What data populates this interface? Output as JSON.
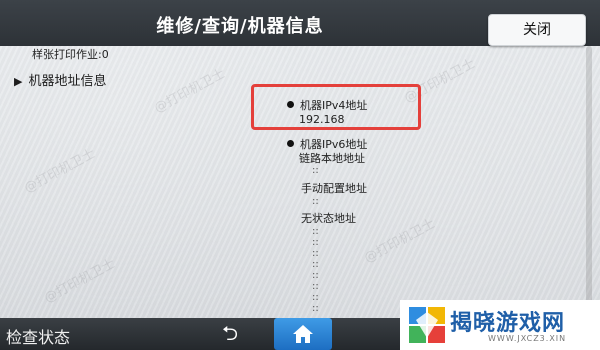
{
  "header": {
    "title": "维修/查询/机器信息",
    "close_label": "关闭"
  },
  "content": {
    "partial_line": "样张打印作业:0",
    "section_label": "机器地址信息",
    "ipv4": {
      "label": "机器IPv4地址",
      "value": "192.168"
    },
    "ipv6": {
      "label": "机器IPv6地址",
      "link_local_label": "链路本地地址",
      "link_local_value": "::",
      "manual_label": "手动配置地址",
      "manual_value": "::",
      "stateless_label": "无状态地址",
      "stateless_values": [
        "::",
        "::",
        "::",
        "::",
        "::",
        "::",
        "::",
        "::"
      ]
    }
  },
  "bottom": {
    "status_label": "检查状态",
    "back_icon": "back-arrow-icon",
    "home_icon": "home-icon"
  },
  "watermark": {
    "site_name": "揭晓游戏网",
    "site_url": "WWW.JXCZ3.XIN",
    "overlay_text": "@打印机卫士"
  },
  "colors": {
    "header_bg": "#2d3237",
    "highlight_border": "#e4403b",
    "home_button": "#2a82d4",
    "logo_text": "#1f5fa8"
  }
}
